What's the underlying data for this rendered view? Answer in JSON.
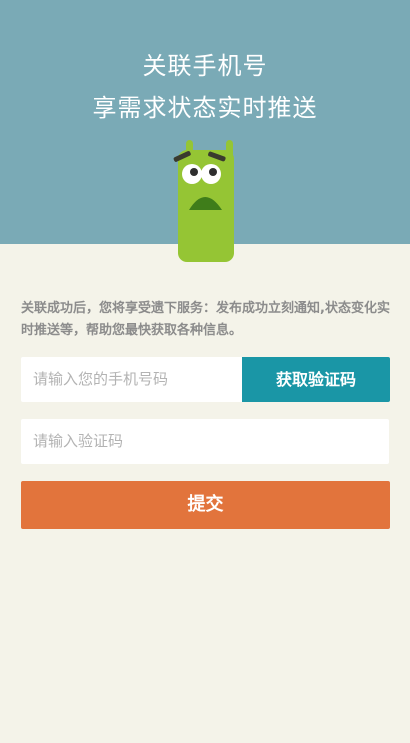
{
  "header": {
    "title_line1": "关联手机号",
    "title_line2": "享需求状态实时推送"
  },
  "description": "关联成功后，您将享受遗下服务：发布成功立刻通知,状态变化实时推送等，帮助您最快获取各种信息。",
  "form": {
    "phone_placeholder": "请输入您的手机号码",
    "get_code_label": "获取验证码",
    "code_placeholder": "请输入验证码",
    "submit_label": "提交"
  },
  "mascot": {
    "icon": "green-monster-mascot-icon"
  },
  "colors": {
    "header_bg": "#7aaab6",
    "page_bg": "#f4f3e9",
    "code_button_bg": "#1a96a6",
    "submit_bg": "#e2743c",
    "mascot_green": "#95c534"
  }
}
